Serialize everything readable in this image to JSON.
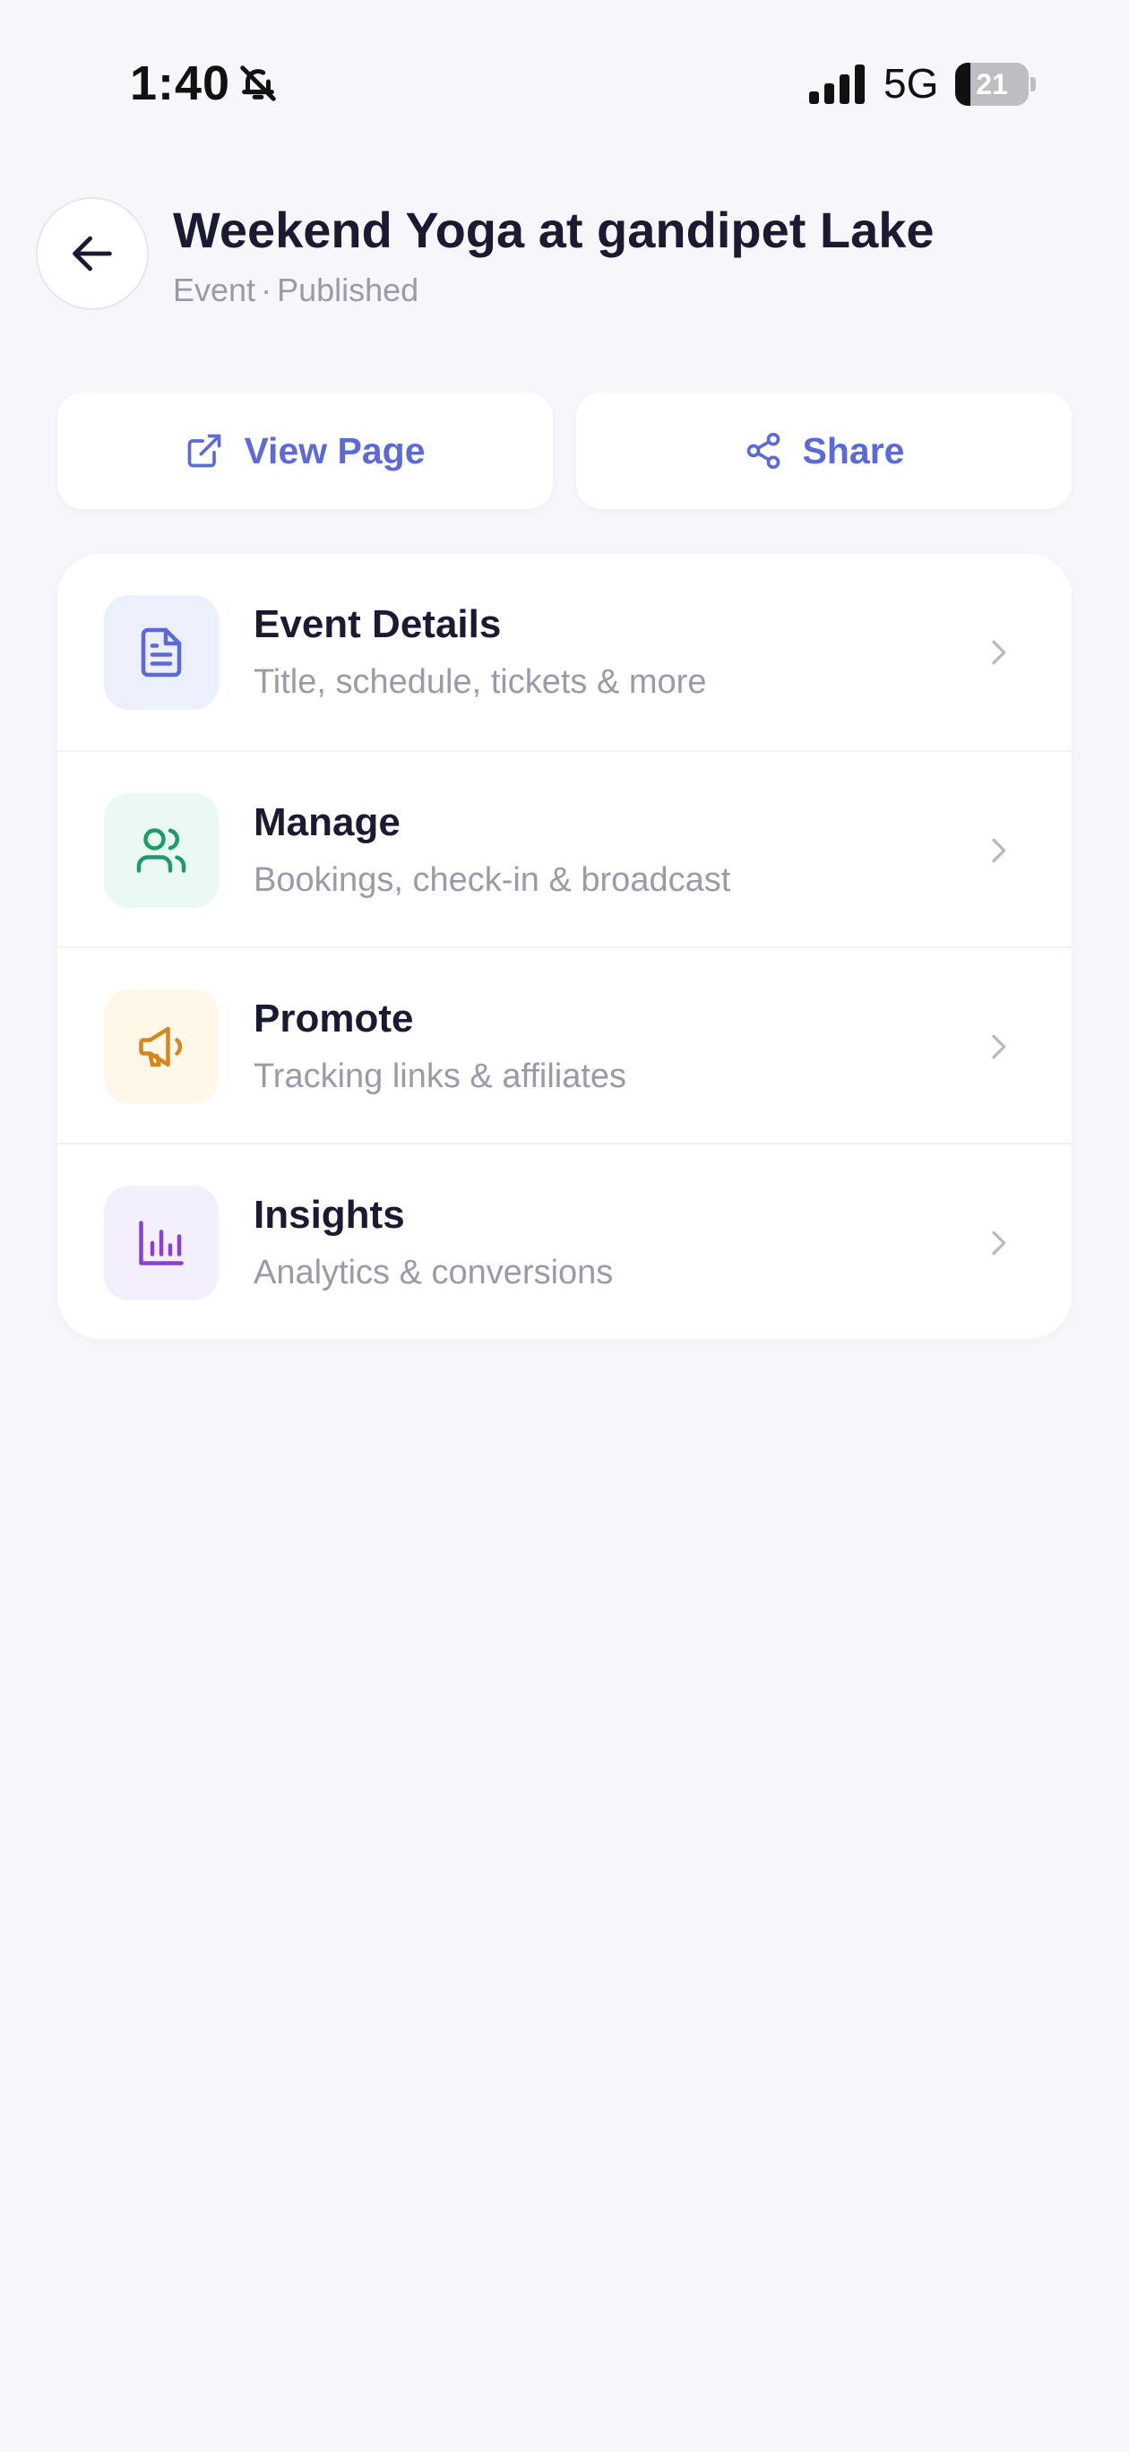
{
  "status_bar": {
    "time": "1:40",
    "network": "5G",
    "battery_level": "21",
    "battery_fraction": 0.21
  },
  "header": {
    "title": "Weekend Yoga at gandipet Lake",
    "type": "Event",
    "separator": "·",
    "status": "Published"
  },
  "actions": {
    "view_page_label": "View Page",
    "share_label": "Share",
    "accent_color": "#5b6ad8"
  },
  "menu": {
    "items": [
      {
        "title": "Event Details",
        "description": "Title, schedule, tickets & more",
        "icon": "document-icon",
        "icon_color": "#5b6ad8",
        "icon_bg": "#ecf0fd"
      },
      {
        "title": "Manage",
        "description": "Bookings, check-in & broadcast",
        "icon": "users-icon",
        "icon_color": "#1f9a6b",
        "icon_bg": "#eafaf2"
      },
      {
        "title": "Promote",
        "description": "Tracking links & affiliates",
        "icon": "megaphone-icon",
        "icon_color": "#d6861c",
        "icon_bg": "#fff8e8"
      },
      {
        "title": "Insights",
        "description": "Analytics & conversions",
        "icon": "bar-chart-icon",
        "icon_color": "#8a3fd8",
        "icon_bg": "#f4effd"
      }
    ]
  }
}
